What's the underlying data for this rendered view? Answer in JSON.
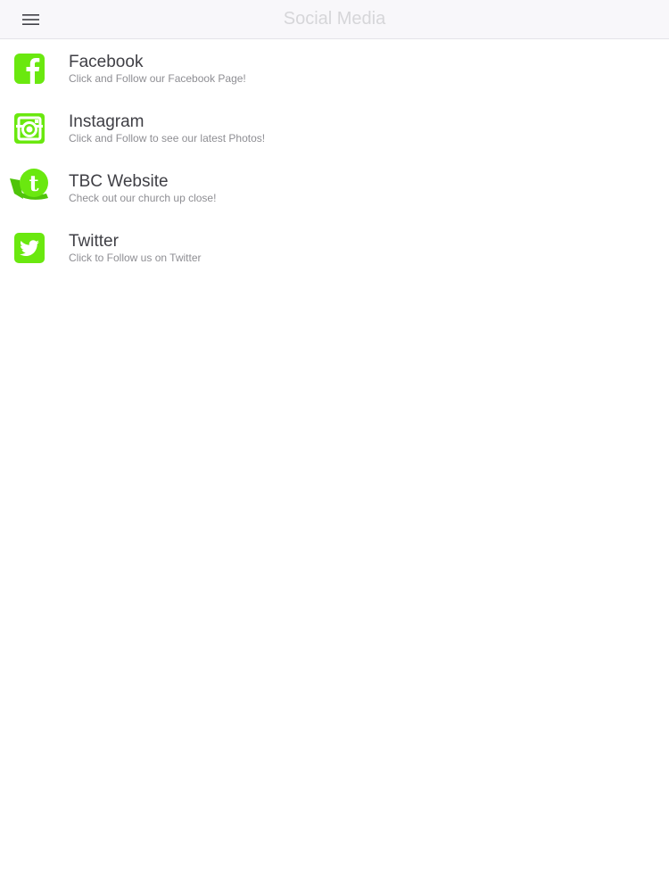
{
  "nav": {
    "title": "Social Media",
    "menu_icon": "hamburger-menu-icon"
  },
  "colors": {
    "accent_green": "#6ae80f",
    "title_gray": "#d6d6d9",
    "text_dark": "#3f3f45",
    "text_sub": "#8e8e93"
  },
  "items": [
    {
      "title": "Facebook",
      "subtitle": "Click and Follow our Facebook Page!",
      "icon": "facebook-icon"
    },
    {
      "title": "Instagram",
      "subtitle": "Click and Follow to see our latest Photos!",
      "icon": "instagram-icon"
    },
    {
      "title": "TBC Website",
      "subtitle": "Check out our church up close!",
      "icon": "tbc-website-icon"
    },
    {
      "title": "Twitter",
      "subtitle": "Click to Follow us on Twitter",
      "icon": "twitter-icon"
    }
  ]
}
